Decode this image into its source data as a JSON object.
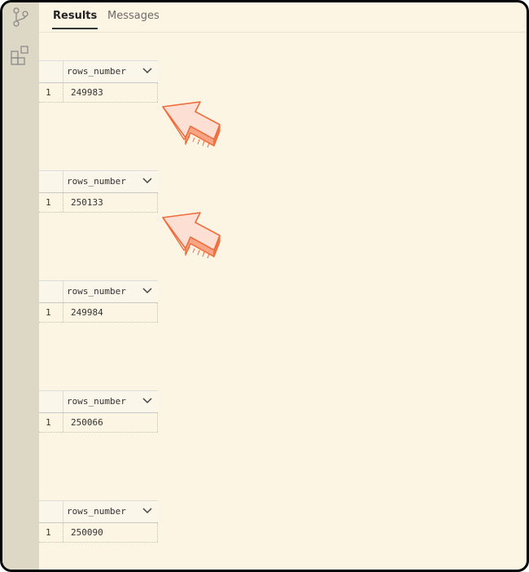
{
  "tabs": [
    {
      "label": "Results",
      "active": true
    },
    {
      "label": "Messages",
      "active": false
    }
  ],
  "activity_bar": {
    "icons": [
      "source-control-icon",
      "extensions-icon"
    ]
  },
  "results": [
    {
      "column": "rows_number",
      "row_number": "1",
      "value": "249983"
    },
    {
      "column": "rows_number",
      "row_number": "1",
      "value": "250133"
    },
    {
      "column": "rows_number",
      "row_number": "1",
      "value": "249984"
    },
    {
      "column": "rows_number",
      "row_number": "1",
      "value": "250066"
    },
    {
      "column": "rows_number",
      "row_number": "1",
      "value": "250090"
    }
  ],
  "annotations": {
    "arrow_color": "#f06a3a",
    "count": 2
  }
}
